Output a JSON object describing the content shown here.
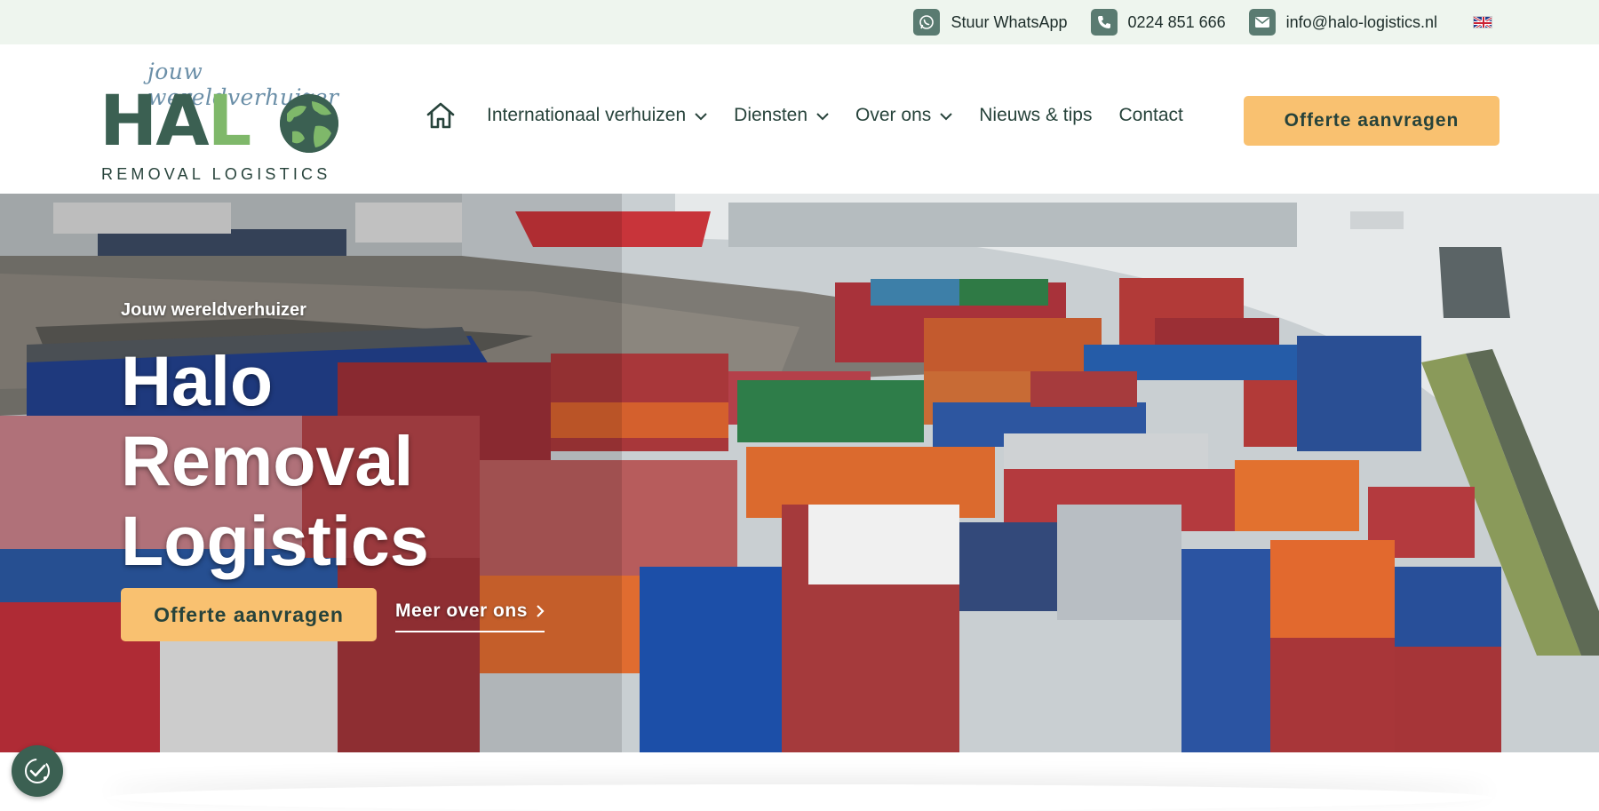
{
  "topbar": {
    "whatsapp_label": "Stuur WhatsApp",
    "phone_label": "0224 851 666",
    "email_label": "info@halo-logistics.nl",
    "language_icon": "uk-flag-icon"
  },
  "logo": {
    "tagline": "jouw wereldverhuizer",
    "name_part1": "HA",
    "name_part2": "L",
    "subtitle": "REMOVAL LOGISTICS"
  },
  "nav": {
    "items": [
      {
        "label": "Internationaal verhuizen",
        "dropdown": true
      },
      {
        "label": "Diensten",
        "dropdown": true
      },
      {
        "label": "Over ons",
        "dropdown": true
      },
      {
        "label": "Nieuws & tips",
        "dropdown": false
      },
      {
        "label": "Contact",
        "dropdown": false
      }
    ],
    "cta_label": "Offerte aanvragen"
  },
  "hero": {
    "tagline": "Jouw wereldverhuizer",
    "title_line1": "Halo",
    "title_line2": "Removal",
    "title_line3": "Logistics",
    "cta_label": "Offerte aanvragen",
    "link_label": "Meer over ons"
  },
  "colors": {
    "topbar_bg": "#eef5ee",
    "brand_dark": "#3b6052",
    "brand_green": "#7fb86a",
    "accent": "#f9c170",
    "text_dark": "#27433b"
  }
}
